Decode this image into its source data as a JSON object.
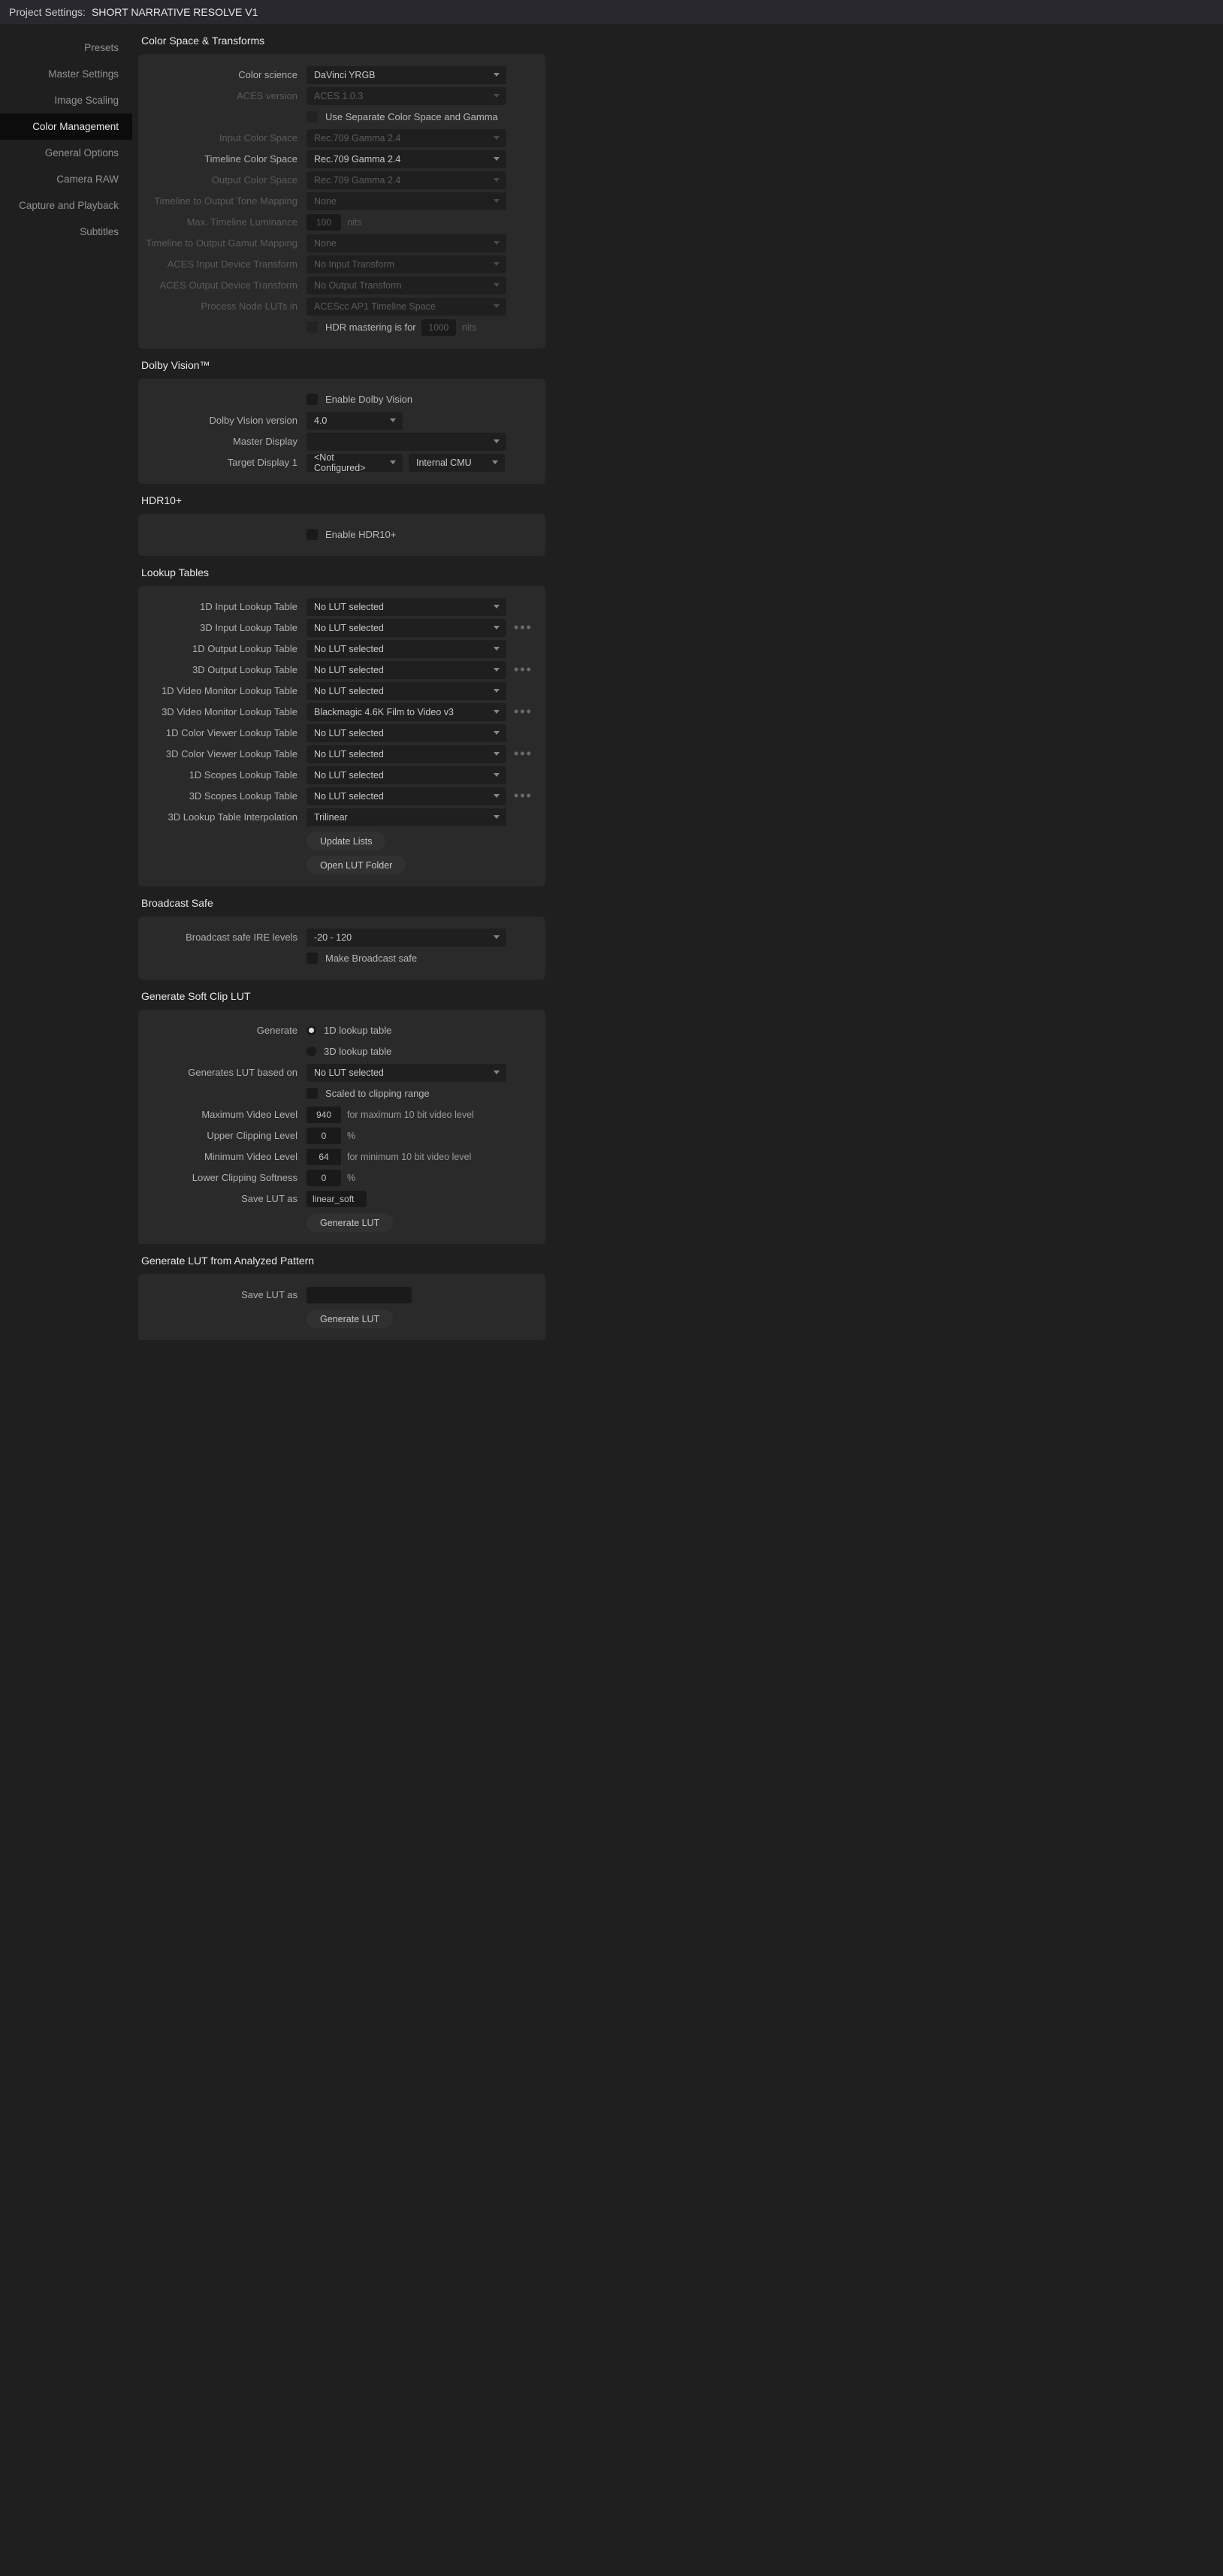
{
  "title": {
    "prefix": "Project Settings:",
    "name": "SHORT NARRATIVE RESOLVE V1"
  },
  "sidebar": {
    "items": [
      "Presets",
      "Master Settings",
      "Image Scaling",
      "Color Management",
      "General Options",
      "Camera RAW",
      "Capture and Playback",
      "Subtitles"
    ],
    "active": 3
  },
  "sections": {
    "cst": {
      "title": "Color Space & Transforms",
      "color_science": {
        "label": "Color science",
        "value": "DaVinci YRGB"
      },
      "aces_version": {
        "label": "ACES version",
        "value": "ACES 1.0.3"
      },
      "use_separate": {
        "label": "Use Separate Color Space and Gamma"
      },
      "input_cs": {
        "label": "Input Color Space",
        "value": "Rec.709 Gamma 2.4"
      },
      "timeline_cs": {
        "label": "Timeline Color Space",
        "value": "Rec.709 Gamma 2.4"
      },
      "output_cs": {
        "label": "Output Color Space",
        "value": "Rec.709 Gamma 2.4"
      },
      "tone_map": {
        "label": "Timeline to Output Tone Mapping",
        "value": "None"
      },
      "max_lum": {
        "label": "Max. Timeline Luminance",
        "value": "100",
        "unit": "nits"
      },
      "gamut_map": {
        "label": "Timeline to Output Gamut Mapping",
        "value": "None"
      },
      "aces_idt": {
        "label": "ACES Input Device Transform",
        "value": "No Input Transform"
      },
      "aces_odt": {
        "label": "ACES Output Device Transform",
        "value": "No Output Transform"
      },
      "process_luts": {
        "label": "Process Node LUTs in",
        "value": "ACEScc AP1 Timeline Space"
      },
      "hdr_master": {
        "label": "HDR mastering is for",
        "value": "1000",
        "unit": "nits"
      }
    },
    "dolby": {
      "title": "Dolby Vision™",
      "enable": {
        "label": "Enable Dolby Vision"
      },
      "version": {
        "label": "Dolby Vision version",
        "value": "4.0"
      },
      "master": {
        "label": "Master Display",
        "value": ""
      },
      "target": {
        "label": "Target Display 1",
        "value": "<Not Configured>",
        "mode": "Internal CMU"
      }
    },
    "hdr10": {
      "title": "HDR10+",
      "enable": {
        "label": "Enable HDR10+"
      }
    },
    "luts": {
      "title": "Lookup Tables",
      "rows": [
        {
          "label": "1D Input Lookup Table",
          "value": "No LUT selected",
          "dots": false
        },
        {
          "label": "3D Input Lookup Table",
          "value": "No LUT selected",
          "dots": true
        },
        {
          "label": "1D Output Lookup Table",
          "value": "No LUT selected",
          "dots": false
        },
        {
          "label": "3D Output Lookup Table",
          "value": "No LUT selected",
          "dots": true
        },
        {
          "label": "1D Video Monitor Lookup Table",
          "value": "No LUT selected",
          "dots": false
        },
        {
          "label": "3D Video Monitor Lookup Table",
          "value": "Blackmagic 4.6K Film to Video v3",
          "dots": true
        },
        {
          "label": "1D Color Viewer Lookup Table",
          "value": "No LUT selected",
          "dots": false
        },
        {
          "label": "3D Color Viewer Lookup Table",
          "value": "No LUT selected",
          "dots": true
        },
        {
          "label": "1D Scopes Lookup Table",
          "value": "No LUT selected",
          "dots": false
        },
        {
          "label": "3D Scopes Lookup Table",
          "value": "No LUT selected",
          "dots": true
        }
      ],
      "interp": {
        "label": "3D Lookup Table Interpolation",
        "value": "Trilinear"
      },
      "update": "Update Lists",
      "open": "Open LUT Folder"
    },
    "bsafe": {
      "title": "Broadcast Safe",
      "ire": {
        "label": "Broadcast safe IRE levels",
        "value": "-20 - 120"
      },
      "make": {
        "label": "Make Broadcast safe"
      }
    },
    "softclip": {
      "title": "Generate Soft Clip LUT",
      "gen": {
        "label": "Generate",
        "opt1": "1D lookup table",
        "opt2": "3D lookup table"
      },
      "based": {
        "label": "Generates LUT based on",
        "value": "No LUT selected"
      },
      "scaled": {
        "label": "Scaled to clipping range"
      },
      "maxv": {
        "label": "Maximum Video Level",
        "value": "940",
        "hint": "for maximum 10 bit video level"
      },
      "upper": {
        "label": "Upper Clipping Level",
        "value": "0",
        "unit": "%"
      },
      "minv": {
        "label": "Minimum Video Level",
        "value": "64",
        "hint": "for minimum 10 bit video level"
      },
      "lower": {
        "label": "Lower Clipping Softness",
        "value": "0",
        "unit": "%"
      },
      "save": {
        "label": "Save LUT as",
        "value": "linear_soft"
      },
      "btn": "Generate LUT"
    },
    "pattern": {
      "title": "Generate LUT from Analyzed Pattern",
      "save": {
        "label": "Save LUT as",
        "value": ""
      },
      "btn": "Generate LUT"
    }
  }
}
